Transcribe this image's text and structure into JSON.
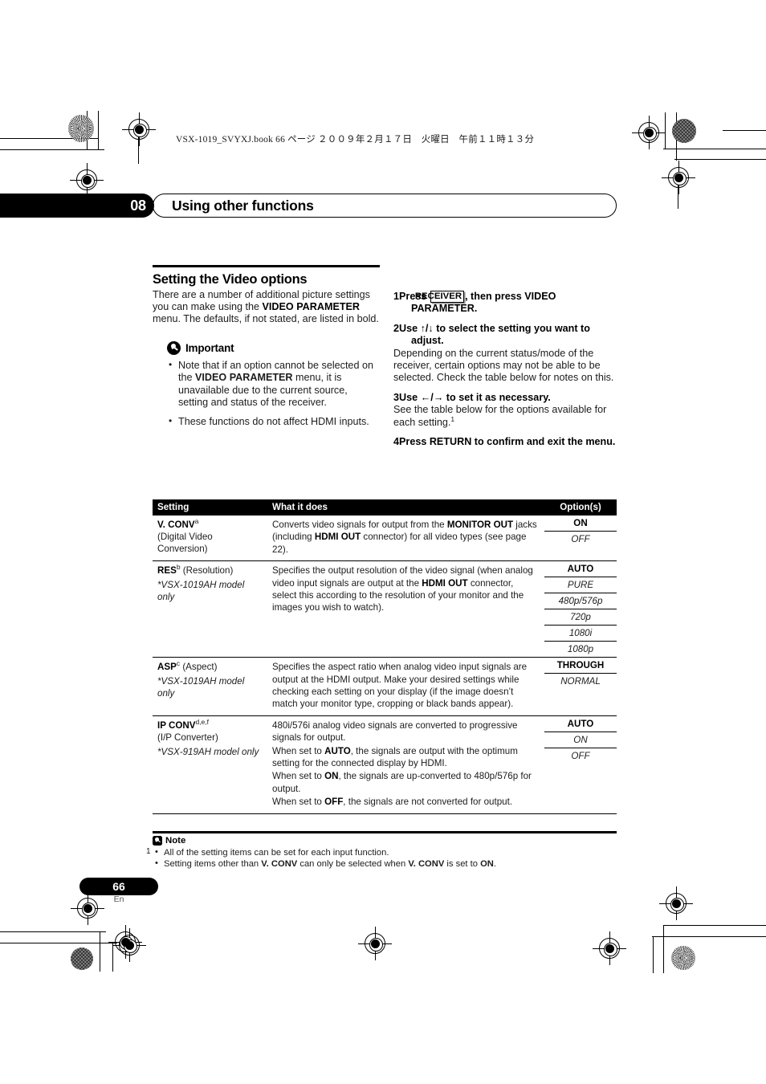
{
  "print_meta": {
    "line": "VSX-1019_SVYXJ.book   66 ページ   ２００９年２月１７日　火曜日　午前１１時１３分"
  },
  "chapter": {
    "number": "08",
    "title": "Using other functions"
  },
  "left_column": {
    "section_title": "Setting the Video options",
    "intro_parts": {
      "p1a": "There are a number of additional picture settings you can make using the ",
      "p1b": "VIDEO PARAMETER",
      "p1c": " menu. The defaults, if not stated, are listed in bold."
    },
    "important": {
      "icon": "pushpin-icon",
      "label": "Important",
      "bullets": [
        {
          "a": "Note that if an option cannot be selected on the ",
          "b": "VIDEO PARAMETER",
          "c": " menu, it is unavailable due to the current source, setting and status of the receiver."
        },
        {
          "a": "These functions do not affect HDMI inputs.",
          "b": "",
          "c": ""
        }
      ]
    }
  },
  "right_column": {
    "steps": [
      {
        "num": "1",
        "text_before": "Press ",
        "keycap": "RECEIVER",
        "text_after": ", then press VIDEO PARAMETER.",
        "body": ""
      },
      {
        "num": "2",
        "text_before": "Use ",
        "keycap": "",
        "text_after": "↑/↓ to select the setting you want to adjust.",
        "body": "Depending on the current status/mode of the receiver, certain options may not be able to be selected. Check the table below for notes on this."
      },
      {
        "num": "3",
        "text_before": "Use ",
        "keycap": "",
        "text_after": "←/→ to set it as necessary.",
        "body": "See the table below for the options available for each setting."
      },
      {
        "num": "4",
        "text_before": "",
        "keycap": "",
        "text_after": "Press RETURN to confirm and exit the menu.",
        "body": ""
      }
    ],
    "step3_footnote": "1"
  },
  "table": {
    "headers": {
      "setting": "Setting",
      "what": "What it does",
      "options": "Option(s)"
    },
    "rows": [
      {
        "setting_name": "V. CONV",
        "setting_sup": "a",
        "setting_sub": "(Digital Video Conversion)",
        "setting_model": "",
        "what_parts": [
          {
            "t": "Converts video signals for output from the ",
            "b": false
          },
          {
            "t": "MONITOR OUT",
            "b": true
          },
          {
            "t": " jacks (including ",
            "b": false
          },
          {
            "t": "HDMI OUT",
            "b": true
          },
          {
            "t": " connector) for all video types (see page 22).",
            "b": false
          }
        ],
        "options": [
          {
            "label": "ON",
            "default": true
          },
          {
            "label": "OFF",
            "default": false
          }
        ]
      },
      {
        "setting_name": "RES",
        "setting_sup": "b",
        "setting_sub": " (Resolution)",
        "setting_model": "*VSX-1019AH model only",
        "what_parts": [
          {
            "t": "Specifies the output resolution of the video signal (when analog video input signals are output at the ",
            "b": false
          },
          {
            "t": "HDMI OUT",
            "b": true
          },
          {
            "t": " connector, select this according to the resolution of your monitor and the images you wish to watch).",
            "b": false
          }
        ],
        "options": [
          {
            "label": "AUTO",
            "default": true
          },
          {
            "label": "PURE",
            "default": false
          },
          {
            "label": "480p/576p",
            "default": false
          },
          {
            "label": "720p",
            "default": false
          },
          {
            "label": "1080i",
            "default": false
          },
          {
            "label": "1080p",
            "default": false
          }
        ]
      },
      {
        "setting_name": "ASP",
        "setting_sup": "c",
        "setting_sub": " (Aspect)",
        "setting_model": "*VSX-1019AH model only",
        "what_parts": [
          {
            "t": "Specifies the aspect ratio when analog video input signals are output at the HDMI output. Make your desired settings while checking each setting on your display (if the image doesn’t match your monitor type, cropping or black bands appear).",
            "b": false
          }
        ],
        "options": [
          {
            "label": "THROUGH",
            "default": true
          },
          {
            "label": "NORMAL",
            "default": false
          }
        ]
      },
      {
        "setting_name": "IP  CONV",
        "setting_sup": "d,e,f",
        "setting_sub": "(I/P Converter)",
        "setting_model": "*VSX-919AH model only",
        "what_paragraphs": [
          [
            {
              "t": "480i/576i analog video signals are converted to progressive signals for output.",
              "b": false
            }
          ],
          [
            {
              "t": "When set to ",
              "b": false
            },
            {
              "t": "AUTO",
              "b": true
            },
            {
              "t": ", the signals are output with the optimum setting for the connected display by HDMI.",
              "b": false
            }
          ],
          [
            {
              "t": "When set to ",
              "b": false
            },
            {
              "t": "ON",
              "b": true
            },
            {
              "t": ", the signals are up-converted to 480p/576p for output.",
              "b": false
            }
          ],
          [
            {
              "t": "When set to ",
              "b": false
            },
            {
              "t": "OFF",
              "b": true
            },
            {
              "t": ", the signals are not converted for output.",
              "b": false
            }
          ]
        ],
        "options": [
          {
            "label": "AUTO",
            "default": true
          },
          {
            "label": "ON",
            "default": false
          },
          {
            "label": "OFF",
            "default": false
          }
        ]
      }
    ]
  },
  "note": {
    "icon": "pushpin-note-icon",
    "label": "Note",
    "index": "1",
    "items": [
      [
        {
          "t": "All of the setting items can be set for each input function.",
          "b": false
        }
      ],
      [
        {
          "t": "Setting items other than ",
          "b": false
        },
        {
          "t": "V. CONV",
          "b": true
        },
        {
          "t": " can only be selected when ",
          "b": false
        },
        {
          "t": "V. CONV",
          "b": true
        },
        {
          "t": " is set to ",
          "b": false
        },
        {
          "t": "ON",
          "b": true
        },
        {
          "t": ".",
          "b": false
        }
      ]
    ]
  },
  "footer": {
    "page_number": "66",
    "language": "En"
  }
}
